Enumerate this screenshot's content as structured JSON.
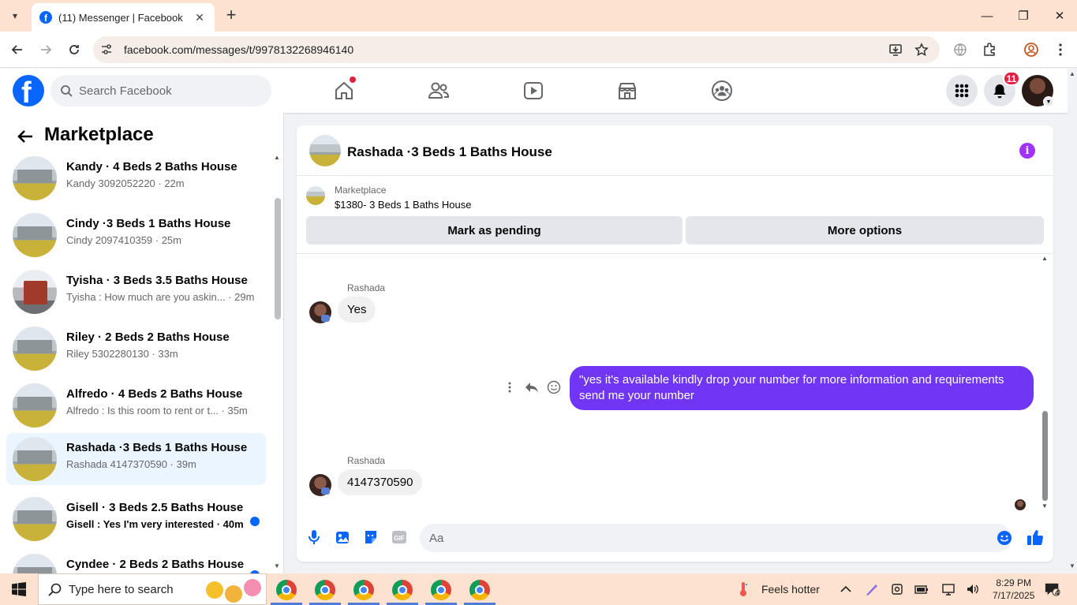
{
  "browser": {
    "tab_title": "(11) Messenger | Facebook",
    "url": "facebook.com/messages/t/9978132268946140"
  },
  "fb_header": {
    "search_placeholder": "Search Facebook",
    "notification_count": "11"
  },
  "sidebar": {
    "title": "Marketplace",
    "conversations": [
      {
        "name": "Kandy · 4 Beds 2 Baths House",
        "preview": "Kandy 3092052220 · 22m",
        "unread": false,
        "active": false
      },
      {
        "name": "Cindy ·3 Beds 1 Baths House",
        "preview": "Cindy 2097410359 · 25m",
        "unread": false,
        "active": false
      },
      {
        "name": "Tyisha · 3 Beds 3.5 Baths House",
        "preview": "Tyisha : How much are you askin... · 29m",
        "unread": false,
        "active": false
      },
      {
        "name": "Riley · 2 Beds 2 Baths House",
        "preview": "Riley 5302280130 · 33m",
        "unread": false,
        "active": false
      },
      {
        "name": "Alfredo · 4 Beds 2 Baths House",
        "preview": "Alfredo : Is this room to rent or t... · 35m",
        "unread": false,
        "active": false
      },
      {
        "name": "Rashada ·3 Beds 1 Baths House",
        "preview": "Rashada 4147370590 · 39m",
        "unread": false,
        "active": true
      },
      {
        "name": "Gisell · 3 Beds 2.5 Baths House",
        "preview": "Gisell : Yes I'm very interested · 40m",
        "unread": true,
        "active": false
      },
      {
        "name": "Cyndee · 2 Beds 2 Baths House",
        "preview": "",
        "unread": true,
        "active": false
      }
    ]
  },
  "chat": {
    "title": "Rashada ·3 Beds 1 Baths House",
    "marketplace_label": "Marketplace",
    "listing": "$1380- 3 Beds 1 Baths House",
    "mark_pending_label": "Mark as pending",
    "more_options_label": "More options",
    "messages": [
      {
        "sender": "Rashada",
        "text": "Yes",
        "direction": "in"
      },
      {
        "sender": "",
        "text": "\"yes it's available kindly drop your number for more information and requirements send me your number",
        "direction": "out"
      },
      {
        "sender": "Rashada",
        "text": "4147370590",
        "direction": "in"
      }
    ],
    "composer_placeholder": "Aa"
  },
  "taskbar": {
    "search_placeholder": "Type here to search",
    "weather": "Feels hotter",
    "time": "8:29 PM",
    "date": "7/17/2025",
    "notification_count": "4"
  },
  "colors": {
    "fb_blue": "#0866ff",
    "outgoing_bubble": "#7135f5",
    "active_conversation": "#ebf5ff",
    "chrome_frame": "#fde2cf"
  }
}
